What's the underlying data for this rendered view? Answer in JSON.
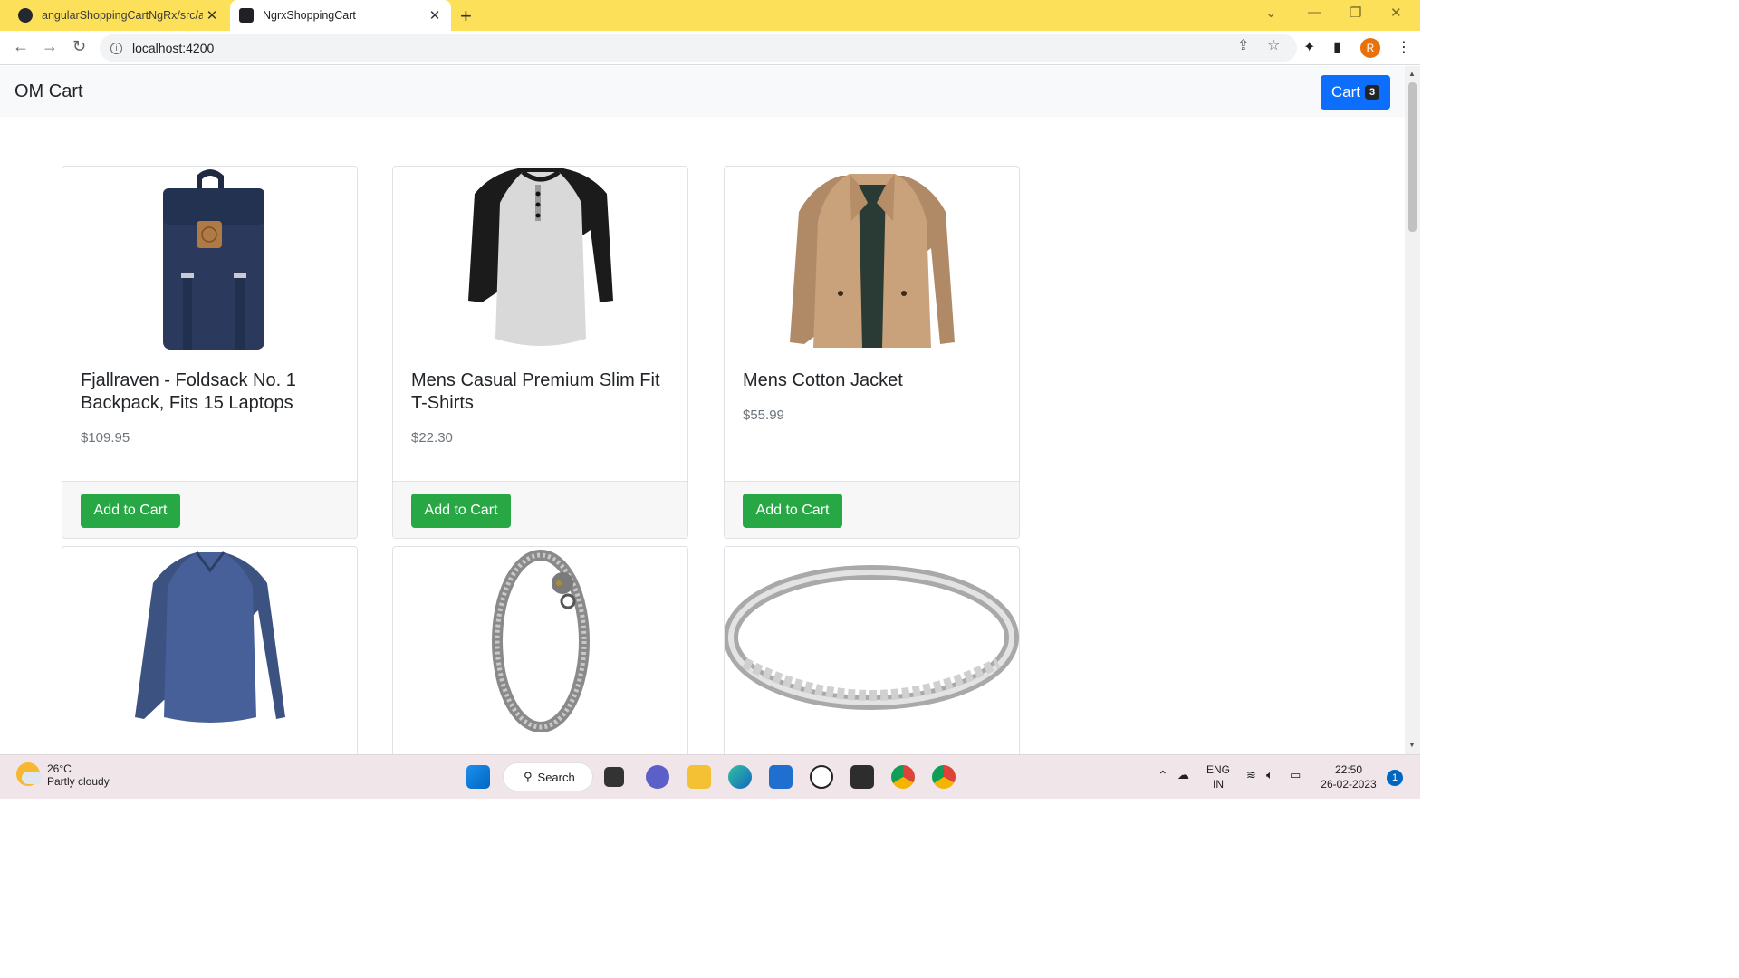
{
  "browser": {
    "tabs": [
      {
        "title": "angularShoppingCartNgRx/src/a",
        "favicon": "github-icon"
      },
      {
        "title": "NgrxShoppingCart",
        "favicon": "angular-icon"
      }
    ],
    "url": "localhost:4200",
    "profile_initial": "R"
  },
  "app": {
    "brand": "OM Cart",
    "cart_label": "Cart",
    "cart_count": "3",
    "add_to_cart_label": "Add to Cart",
    "products": [
      {
        "name": "Fjallraven - Foldsack No. 1 Backpack, Fits 15 Laptops",
        "price": "$109.95",
        "image": "backpack"
      },
      {
        "name": "Mens Casual Premium Slim Fit T-Shirts",
        "price": "$22.30",
        "image": "tshirt"
      },
      {
        "name": "Mens Cotton Jacket",
        "price": "$55.99",
        "image": "jacket"
      },
      {
        "name": "",
        "price": "",
        "image": "long-sleeve-shirt"
      },
      {
        "name": "",
        "price": "",
        "image": "dragon-bracelet"
      },
      {
        "name": "",
        "price": "",
        "image": "silver-ring"
      }
    ]
  },
  "taskbar": {
    "weather_temp": "26°C",
    "weather_desc": "Partly cloudy",
    "search_label": "Search",
    "lang": "ENG",
    "region": "IN",
    "time": "22:50",
    "date": "26-02-2023",
    "notification_count": "1"
  },
  "colors": {
    "tab_strip": "#fde05a",
    "primary": "#0d6efd",
    "success": "#28a745"
  }
}
